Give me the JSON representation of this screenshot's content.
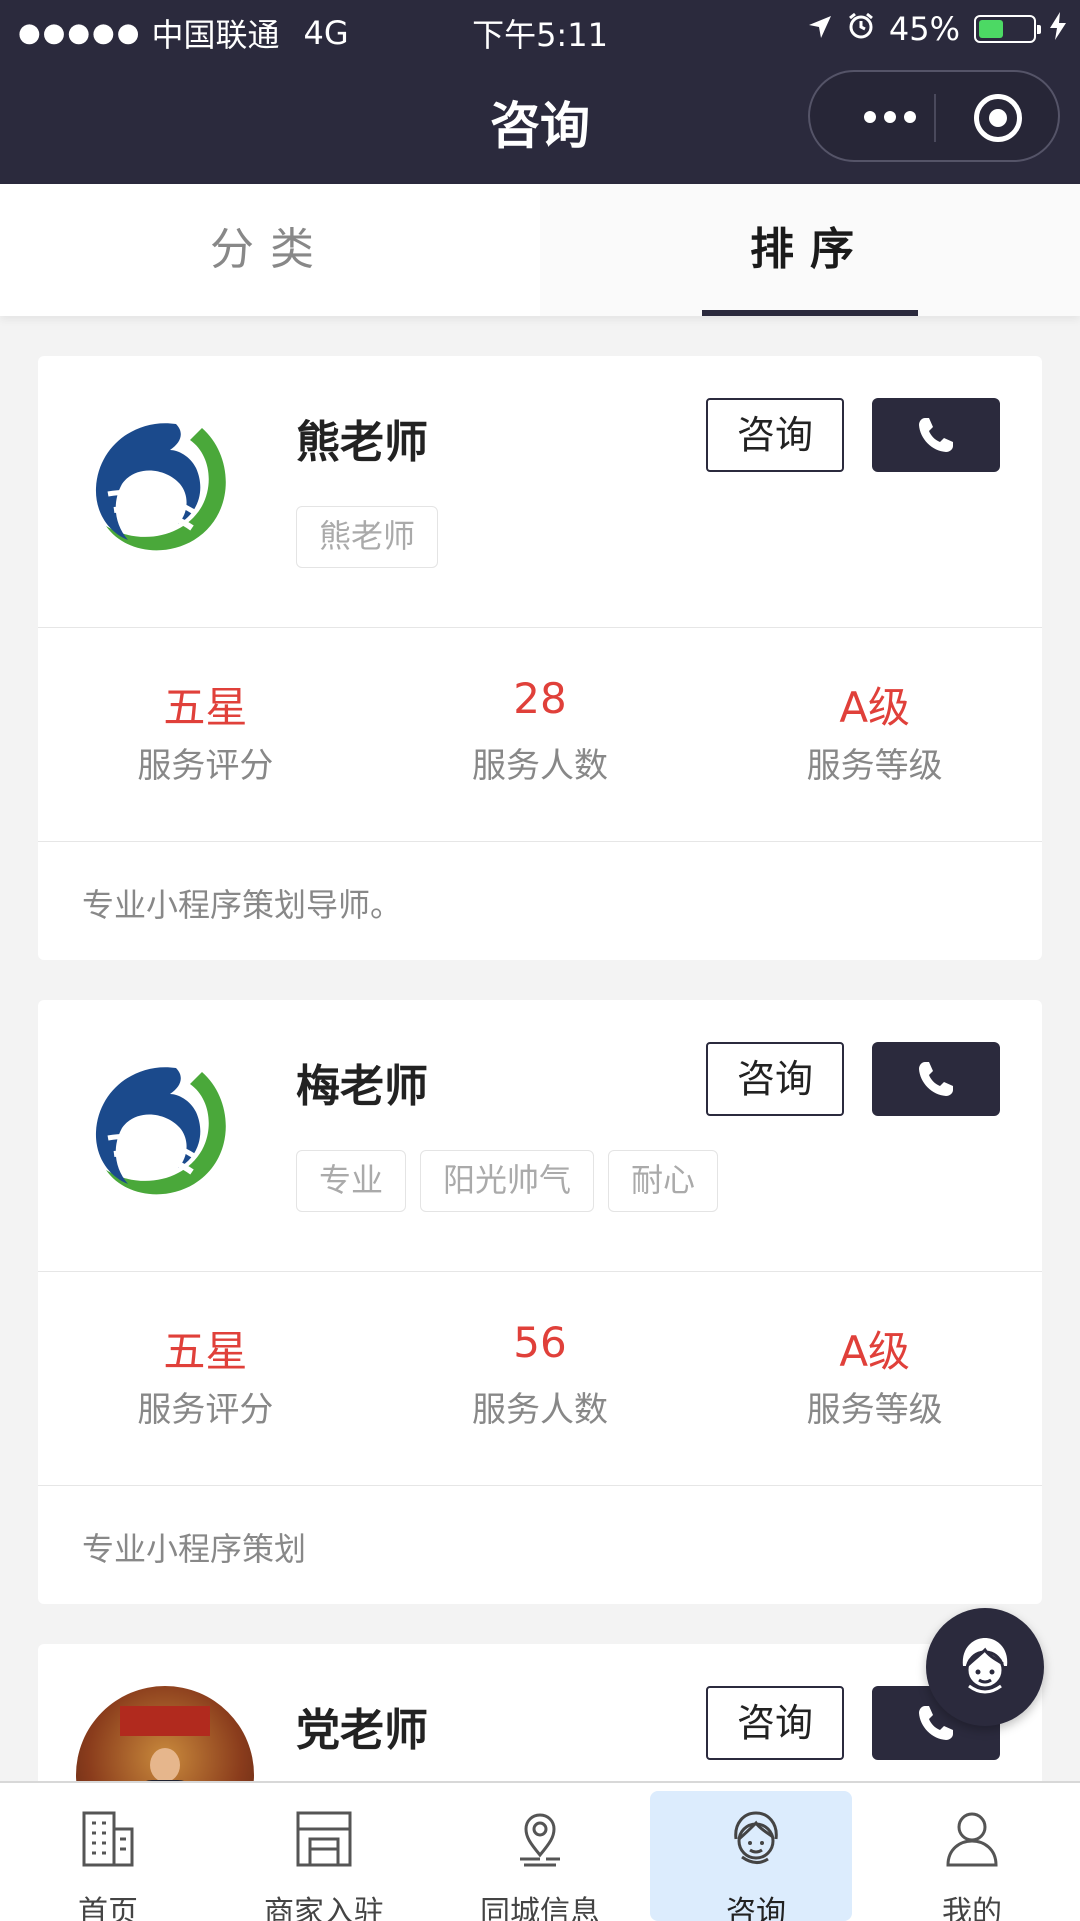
{
  "status_bar": {
    "signal": "●●●●●",
    "carrier": "中国联通",
    "network": "4G",
    "time": "下午5:11",
    "battery": "45%",
    "battery_level": 0.45
  },
  "nav": {
    "title": "咨询"
  },
  "tabs": [
    {
      "label": "分类",
      "active": false
    },
    {
      "label": "排序",
      "active": true
    }
  ],
  "consultants": [
    {
      "name": "熊老师",
      "tags": [
        "熊老师"
      ],
      "consult_label": "咨询",
      "stats": [
        {
          "value": "五星",
          "label": "服务评分"
        },
        {
          "value": "28",
          "label": "服务人数"
        },
        {
          "value": "A级",
          "label": "服务等级"
        }
      ],
      "description": "专业小程序策划导师。"
    },
    {
      "name": "梅老师",
      "tags": [
        "专业",
        "阳光帅气",
        "耐心"
      ],
      "consult_label": "咨询",
      "stats": [
        {
          "value": "五星",
          "label": "服务评分"
        },
        {
          "value": "56",
          "label": "服务人数"
        },
        {
          "value": "A级",
          "label": "服务等级"
        }
      ],
      "description": "专业小程序策划"
    },
    {
      "name": "党老师",
      "tags": [],
      "consult_label": "咨询",
      "stats": [],
      "description": ""
    }
  ],
  "tabbar": [
    {
      "label": "首页",
      "icon": "building-icon",
      "active": false
    },
    {
      "label": "商家入驻",
      "icon": "storefront-icon",
      "active": false
    },
    {
      "label": "同城信息",
      "icon": "location-pin-icon",
      "active": false
    },
    {
      "label": "咨询",
      "icon": "customer-service-icon",
      "active": true
    },
    {
      "label": "我的",
      "icon": "user-icon",
      "active": false
    }
  ],
  "colors": {
    "nav_bg": "#2b2a3d",
    "accent_red": "#e0403a",
    "tab_highlight": "#dcecfd",
    "battery_green": "#4cd964"
  }
}
